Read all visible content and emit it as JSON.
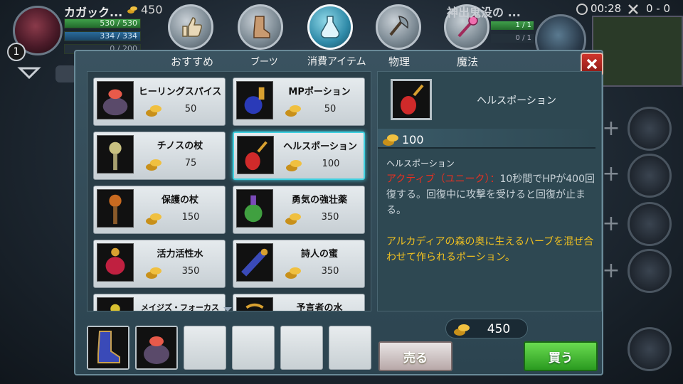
{
  "hud": {
    "player_name": "カガック...",
    "gold": "450",
    "level": "1",
    "hp": "530 / 530",
    "mp": "334 / 334",
    "xp": "0 / 200"
  },
  "enemy": {
    "name": "神出鬼没の ...",
    "bar1": "1 / 1",
    "bar2": "0 / 1"
  },
  "match": {
    "timer": "00:28",
    "score": "0 - 0"
  },
  "tabs": [
    {
      "label": "おすすめ",
      "icon": "thumbs-up-icon"
    },
    {
      "label": "ブーツ",
      "icon": "boots-icon"
    },
    {
      "label": "消費アイテム",
      "icon": "potion-flask-icon",
      "active": true
    },
    {
      "label": "物理",
      "icon": "axe-icon"
    },
    {
      "label": "魔法",
      "icon": "magic-wand-icon"
    }
  ],
  "items": [
    {
      "name": "ヒーリングスパイス",
      "price": "50",
      "icon": "spice-pot-icon"
    },
    {
      "name": "MPポーション",
      "price": "50",
      "icon": "mp-potion-icon"
    },
    {
      "name": "チノスの杖",
      "price": "75",
      "icon": "eye-staff-icon"
    },
    {
      "name": "ヘルスポーション",
      "price": "100",
      "icon": "health-potion-icon",
      "selected": true
    },
    {
      "name": "保護の杖",
      "price": "150",
      "icon": "protection-staff-icon"
    },
    {
      "name": "勇気の強壮薬",
      "price": "350",
      "icon": "courage-tonic-icon"
    },
    {
      "name": "活力活性水",
      "price": "350",
      "icon": "vitality-water-icon"
    },
    {
      "name": "詩人の蜜",
      "price": "350",
      "icon": "poet-nectar-icon"
    },
    {
      "name": "メイジズ・フォーカス",
      "price": "",
      "icon": "mages-focus-icon"
    },
    {
      "name": "予言者の水",
      "price": "",
      "icon": "prophet-water-icon"
    }
  ],
  "detail": {
    "name": "ヘルスポーション",
    "price": "100",
    "subtitle": "ヘルスポーション",
    "active_label": "アクティブ（ユニーク）：",
    "active_text": "10秒間でHPが400回復する。回復中に攻撃を受けると回復が止まる。",
    "lore": "アルカディアの森の奥に生えるハーブを混ぜ合わせて作られるポーション。"
  },
  "inventory": [
    {
      "icon": "boots-icon"
    },
    {
      "icon": "spice-pot-icon"
    },
    {
      "icon": ""
    },
    {
      "icon": ""
    },
    {
      "icon": ""
    },
    {
      "icon": ""
    }
  ],
  "gold_total": "450",
  "buttons": {
    "sell": "売る",
    "buy": "買う"
  },
  "colors": {
    "accent_selected": "#40d0e0",
    "active_text": "#e83020",
    "lore_text": "#f0c020",
    "buy_green": "#2a9a20",
    "close_red": "#d0342c"
  }
}
